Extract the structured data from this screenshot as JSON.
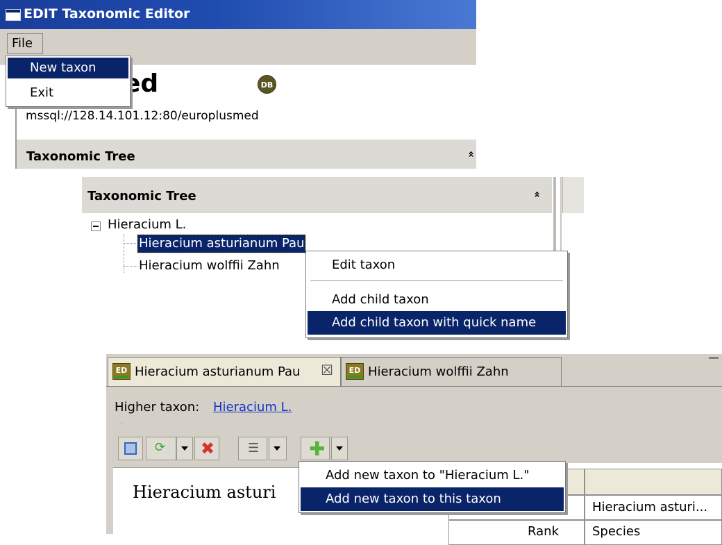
{
  "window1": {
    "title": "EDIT Taxonomic Editor",
    "menu_file": "File",
    "file_menu_items": [
      "New taxon",
      "Exit"
    ],
    "heading_fragment": "ed",
    "db_badge": "DB",
    "db_path": "mssql://128.14.101.12:80/europlusmed",
    "tree_header": "Taxonomic Tree",
    "collapse_glyph": "»"
  },
  "window2": {
    "tree_header": "Taxonomic Tree",
    "collapse_glyph": "»",
    "root": "Hieracium L.",
    "children": [
      "Hieracium asturianum Pau",
      "Hieracium wolffii Zahn"
    ],
    "context_menu": {
      "items": [
        "Edit taxon",
        "Add child taxon",
        "Add child taxon with quick name"
      ],
      "selected_index": 2
    }
  },
  "window3": {
    "tabs": [
      {
        "label": "Hieracium asturianum Pau",
        "icon": "ed-taxon-icon",
        "closable": true,
        "active": true
      },
      {
        "label": "Hieracium wolffii Zahn",
        "icon": "ed-taxon-icon",
        "closable": false,
        "active": false
      }
    ],
    "tab_icon_text": "ED",
    "close_glyph": "☒",
    "higher_taxon_label": "Higher taxon:",
    "higher_taxon_link": "Hieracium L.",
    "editor_text": "Hieracium asturi",
    "props": {
      "rows": [
        {
          "key": "",
          "value": "Hieracium asturi..."
        },
        {
          "key": "Rank",
          "value": "Species"
        }
      ]
    },
    "toolbar_icons": {
      "save": "save-icon",
      "redo": "redo-icon",
      "delete": "delete-icon",
      "list": "list-icon",
      "add": "add-icon"
    },
    "toolbar_glyphs": {
      "redo": "⟳",
      "delete": "✖",
      "list": "☰",
      "add": "✚"
    },
    "add_menu": {
      "items": [
        "Add new taxon to \"Hieracium L.\"",
        "Add new taxon to this taxon"
      ],
      "selected_index": 1
    }
  },
  "colors": {
    "selection": "#0a246a",
    "titlebar": "#1f4cb0",
    "menubar": "#d4d0c8",
    "link": "#1632c8"
  }
}
